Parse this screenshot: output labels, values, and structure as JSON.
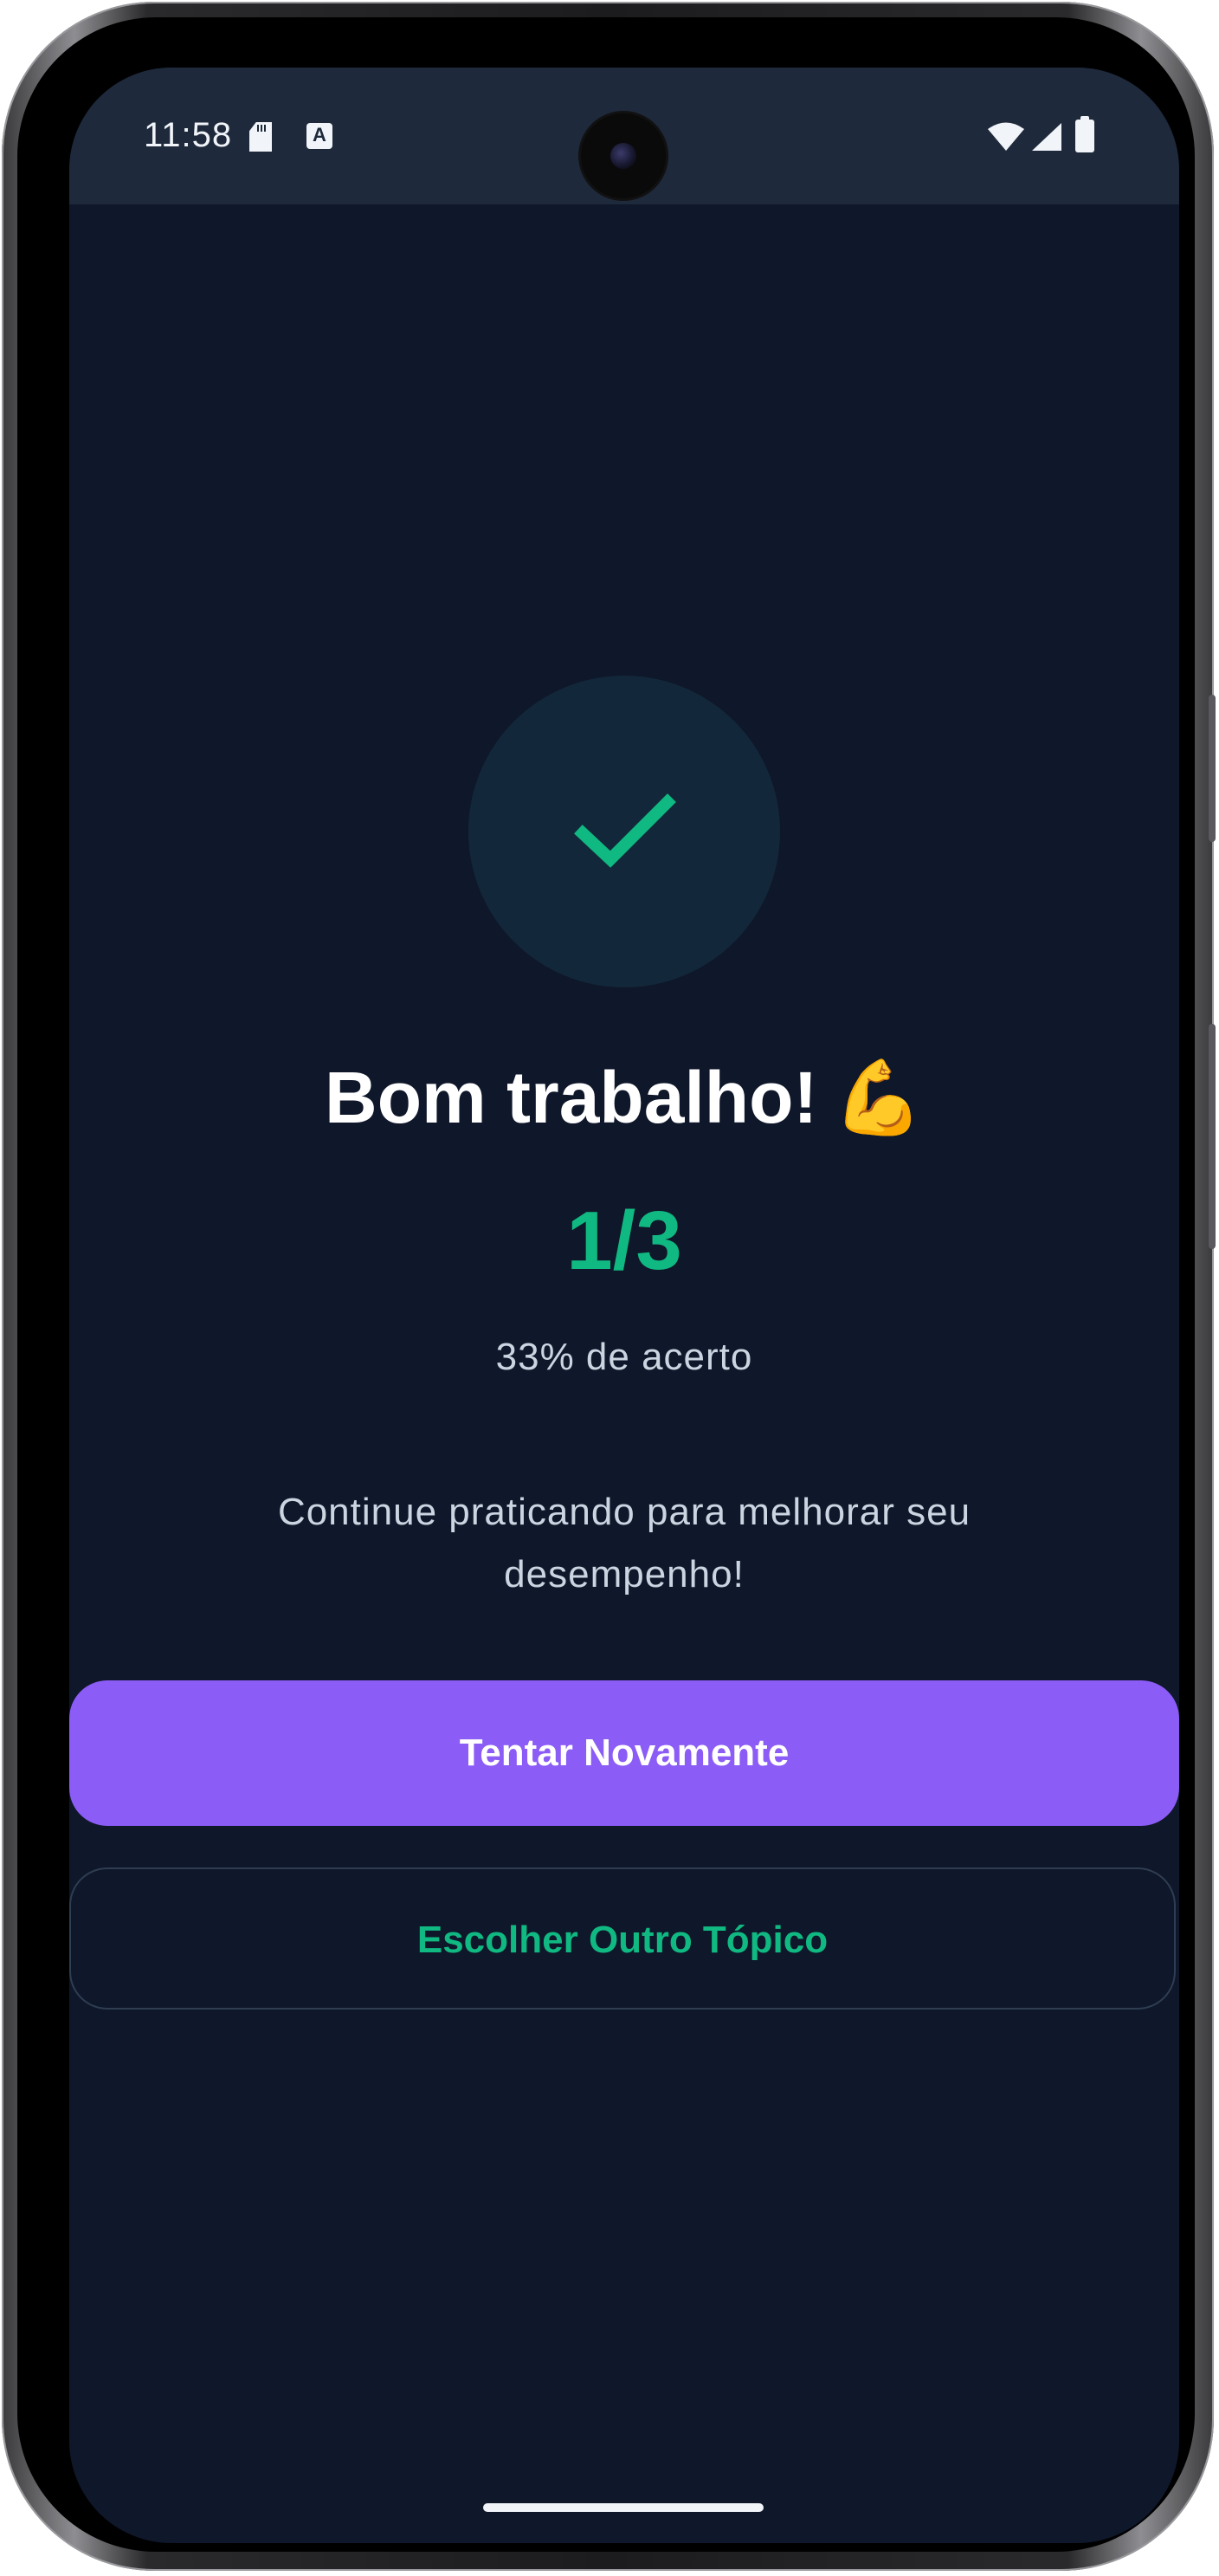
{
  "status_bar": {
    "time": "11:58",
    "notification_icons": [
      "sd-card-icon",
      "keyboard-a-icon"
    ],
    "system_icons": [
      "wifi-icon",
      "signal-icon",
      "battery-icon"
    ],
    "a_glyph": "A"
  },
  "result": {
    "icon": "check-icon",
    "title": "Bom trabalho!",
    "title_emoji": "💪",
    "score": "1/3",
    "percent_text": "33% de acerto",
    "message": "Continue praticando para melhorar seu desempenho!"
  },
  "actions": {
    "retry_label": "Tentar Novamente",
    "choose_topic_label": "Escolher Outro Tópico"
  },
  "colors": {
    "background": "#0f172a",
    "status_bar": "#1e293b",
    "accent_green": "#10b981",
    "primary_button": "#8b5cf6"
  }
}
